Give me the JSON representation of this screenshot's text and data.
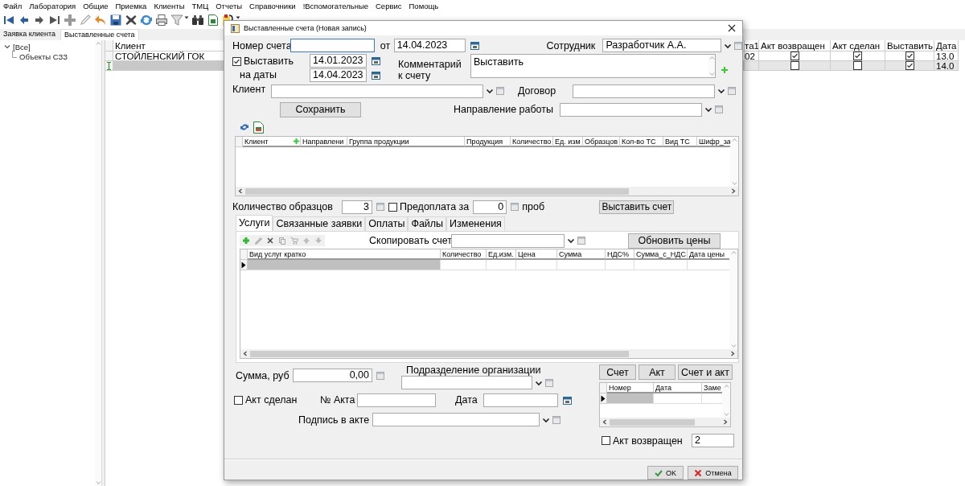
{
  "menu": [
    "Файл",
    "Лаборатория",
    "Общие",
    "Приемка",
    "Клиенты",
    "ТМЦ",
    "Отчеты",
    "Справочники",
    "!Вспомогательные",
    "Сервис",
    "Помощь"
  ],
  "tabs": [
    {
      "label": "Заявка клиента",
      "selected": false
    },
    {
      "label": "Выставленные счета",
      "selected": true
    }
  ],
  "tree": [
    {
      "label": "[Все]",
      "expanded": true,
      "children": [
        {
          "label": "Объекты СЗЗ"
        }
      ]
    }
  ],
  "grid": {
    "columns": [
      "Клиент",
      "та1",
      "Акт  возвращен",
      "Акт  сделан",
      "Выставить",
      "Дата"
    ],
    "rows": [
      {
        "selected": false,
        "editing": false,
        "client": "СТОЙЛЕНСКИЙ ГОК",
        "column_2": "02",
        "act_returned": true,
        "act_done": true,
        "issue": true,
        "date": "13.0"
      },
      {
        "selected": true,
        "editing": true,
        "act_returned": false,
        "act_done": false,
        "issue": true,
        "date": "14.0"
      }
    ]
  },
  "dialog": {
    "title": "Выставленные счета (Новая запись)",
    "invoice_number": {
      "label": "Номер счета"
    },
    "date": {
      "label": "от",
      "value": "14.04.2023"
    },
    "employee": {
      "label": "Сотрудник",
      "value": "Разработчик А.А."
    },
    "issue_dates": {
      "label_1": "Выставить",
      "label_2": "на даты",
      "checked": true,
      "from": "14.01.2023",
      "to": "14.04.2023"
    },
    "comment": {
      "label_1": "Комментарий",
      "label_2": "к счету",
      "value": "Выставить"
    },
    "client": {
      "label": "Клиент"
    },
    "contract": {
      "label": "Договор"
    },
    "save_button": "Сохранить",
    "work_direction": {
      "label": "Направление работы"
    },
    "products_grid": {
      "columns": [
        "Клиент",
        "Направлени",
        "Группа продукции",
        "Продукция",
        "Количество",
        "Ед. изм",
        "Образцов",
        "Кол-во ТС",
        "Вид ТС",
        "Шифр_за"
      ]
    },
    "samples": {
      "label": "Количество образцов",
      "value": "3"
    },
    "prepayment": {
      "label": "Предоплата за",
      "checked": false,
      "value": "0",
      "unit": "проб"
    },
    "issue_button": "Выставить счет",
    "tabs": [
      {
        "label": "Услуги",
        "selected": true
      },
      {
        "label": "Связанные заявки",
        "selected": false
      },
      {
        "label": "Оплаты",
        "selected": false
      },
      {
        "label": "Файлы",
        "selected": false
      },
      {
        "label": "Изменения",
        "selected": false
      }
    ],
    "copy_invoice": {
      "label": "Скопировать счет"
    },
    "update_prices_button": "Обновить цены",
    "services_grid": {
      "columns": [
        "Вид услуг кратко",
        "Количество",
        "Ед.изм.",
        "Цена",
        "Сумма",
        "НДС%",
        "Сумма_с_НДС",
        "Дата цены"
      ],
      "rows": [
        {
          "selected": true
        }
      ]
    },
    "sum": {
      "label": "Сумма, руб",
      "value": "0,00"
    },
    "division": {
      "label": "Подразделение организации"
    },
    "print_buttons": [
      "Счет",
      "Акт",
      "Счет и акт"
    ],
    "acts_grid": {
      "columns": [
        "Номер",
        "Дата",
        "Заме"
      ],
      "rows": [
        {
          "selected": true
        }
      ]
    },
    "act_done": {
      "label": "Акт сделан",
      "checked": false
    },
    "act_number": {
      "label": "№ Акта"
    },
    "act_date": {
      "label": "Дата"
    },
    "signature": {
      "label": "Подпись в акте"
    },
    "act_returned": {
      "label": "Акт возвращен",
      "checked": false,
      "value": "2"
    },
    "buttons": [
      {
        "label": "OK",
        "kind": "ok"
      },
      {
        "label": "Отмена",
        "kind": "cancel"
      }
    ]
  }
}
